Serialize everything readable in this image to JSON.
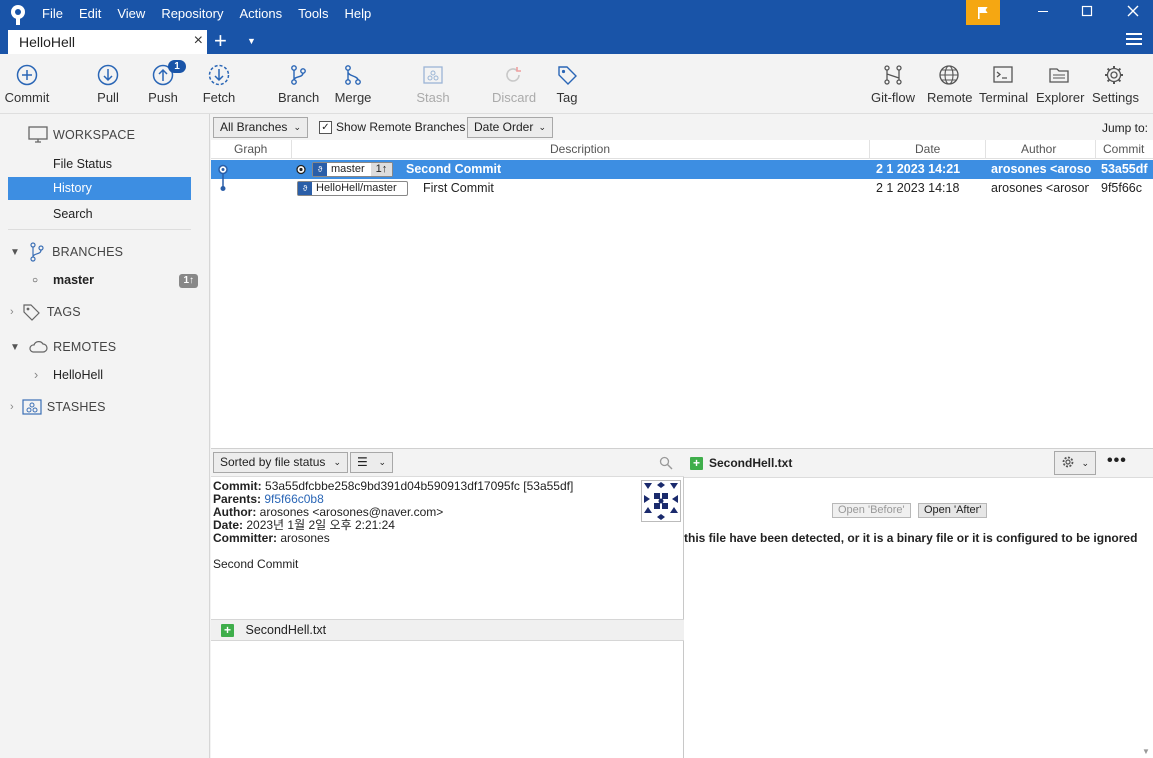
{
  "app": {
    "menus": [
      "File",
      "Edit",
      "View",
      "Repository",
      "Actions",
      "Tools",
      "Help"
    ],
    "tab_title": "HelloHell",
    "accent": "#1954a8",
    "selection": "#3d8ee2",
    "flag_color": "#f5a712"
  },
  "toolbar": {
    "commit": "Commit",
    "pull": "Pull",
    "push": "Push",
    "push_badge": "1",
    "fetch": "Fetch",
    "branch": "Branch",
    "merge": "Merge",
    "stash": "Stash",
    "discard": "Discard",
    "tag": "Tag",
    "gitflow": "Git-flow",
    "remote": "Remote",
    "terminal": "Terminal",
    "explorer": "Explorer",
    "settings": "Settings"
  },
  "sidebar": {
    "workspace": "WORKSPACE",
    "file_status": "File Status",
    "history": "History",
    "search": "Search",
    "branches": "BRANCHES",
    "master": "master",
    "master_badge": "1↑",
    "tags": "TAGS",
    "remotes": "REMOTES",
    "remote_hellohell": "HelloHell",
    "stashes": "STASHES"
  },
  "history_toolbar": {
    "branch_filter": "All Branches",
    "show_remote": "Show Remote Branches",
    "order": "Date Order",
    "jump_to": "Jump to:"
  },
  "columns": {
    "graph": "Graph",
    "description": "Description",
    "date": "Date",
    "author": "Author",
    "commit": "Commit"
  },
  "commits": [
    {
      "ref": "master",
      "ref_badge": "1↑",
      "message": "Second Commit",
      "date": "2 1 2023 14:21",
      "author": "arosones <aroso",
      "hash": "53a55df"
    },
    {
      "ref": "HelloHell/master",
      "message": "First Commit",
      "date": "2 1 2023 14:18",
      "author": "arosones <arosone",
      "hash": "9f5f66c"
    }
  ],
  "details": {
    "sort": "Sorted by file status",
    "commit_label": "Commit:",
    "commit_value": "53a55dfcbbe258c9bd391d04b590913df17095fc [53a55df]",
    "parents_label": "Parents:",
    "parents_value": "9f5f66c0b8",
    "author_label": "Author:",
    "author_value": "arosones <arosones@naver.com>",
    "date_label": "Date:",
    "date_value": "2023년 1월 2일 오후 2:21:24",
    "committer_label": "Committer:",
    "committer_value": "arosones",
    "message": "Second Commit",
    "file": "SecondHell.txt"
  },
  "diff": {
    "file": "SecondHell.txt",
    "open_before": "Open 'Before'",
    "open_after": "Open 'After'",
    "message": "this file have been detected, or it is a binary file or it is configured to be ignored by t"
  }
}
